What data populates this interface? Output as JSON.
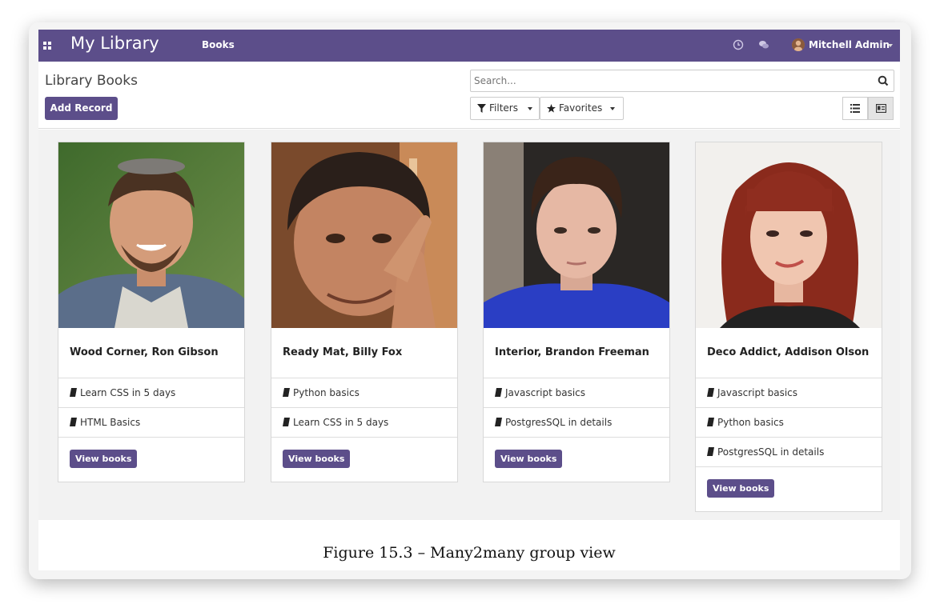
{
  "navbar": {
    "app_title": "My Library",
    "menu_books": "Books",
    "user_name": "Mitchell Admin",
    "color": "#5c4e8a"
  },
  "control_panel": {
    "breadcrumb": "Library Books",
    "add_record_label": "Add Record",
    "search_placeholder": "Search...",
    "filters_label": "Filters",
    "favorites_label": "Favorites"
  },
  "cards": [
    {
      "title": "Wood Corner, Ron Gibson",
      "books": [
        "Learn CSS in 5 days",
        "HTML Basics"
      ],
      "button": "View books"
    },
    {
      "title": "Ready Mat, Billy Fox",
      "books": [
        "Python basics",
        "Learn CSS in 5 days"
      ],
      "button": "View books"
    },
    {
      "title": "Interior, Brandon Freeman",
      "books": [
        "Javascript basics",
        "PostgresSQL in details"
      ],
      "button": "View books"
    },
    {
      "title": "Deco Addict, Addison Olson",
      "books": [
        "Javascript basics",
        "Python basics",
        "PostgresSQL in details"
      ],
      "button": "View books"
    }
  ],
  "caption": "Figure 15.3 – Many2many group view"
}
